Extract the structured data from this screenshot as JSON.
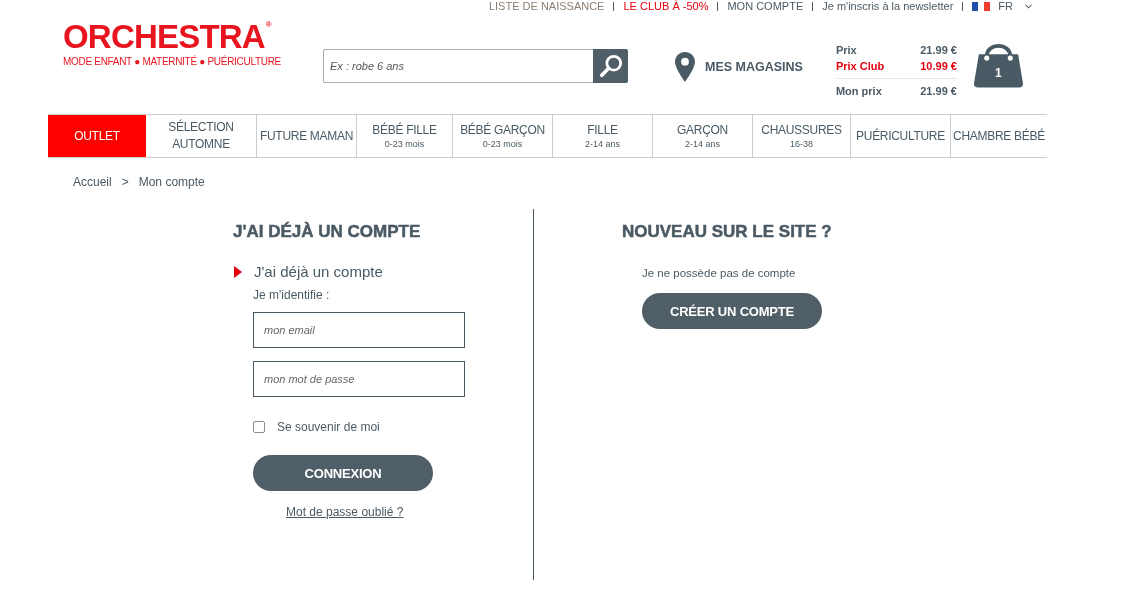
{
  "top_links": [
    {
      "label": "LISTE DE NAISSANCE",
      "color": "#8c7d70"
    },
    {
      "label": "LE CLUB À -50%",
      "color": "#e3000f"
    },
    {
      "label": "MON COMPTE",
      "color": "#4a5a64"
    },
    {
      "label": "Je m'inscris à la newsletter",
      "color": "#4a5a64"
    }
  ],
  "language": {
    "label": "FR"
  },
  "header": {
    "logo": {
      "name": "ORCHESTRA",
      "mark": "®",
      "tagline": "MODE ENFANT ● MATERNITÉ ● PUÉRICULTURE"
    },
    "search": {
      "placeholder": "Ex : robe 6 ans"
    },
    "stores": {
      "label": "MES MAGASINS"
    },
    "prices": [
      {
        "label": "Prix",
        "value": "21.99 €",
        "kind": "regular"
      },
      {
        "label": "Prix Club",
        "value": "10.99 €",
        "kind": "club"
      },
      {
        "label": "Mon prix",
        "value": "21.99 €",
        "kind": "total"
      }
    ],
    "cart": {
      "count": "1"
    }
  },
  "nav": [
    {
      "label": "OUTLET",
      "kind": "promo"
    },
    {
      "label": "SÉLECTION AUTOMNE",
      "kind": "category"
    },
    {
      "label": "FUTURE MAMAN",
      "kind": "category"
    },
    {
      "label": "BÉBÉ FILLE",
      "sublabel": "0-23 mois",
      "kind": "category"
    },
    {
      "label": "BÉBÉ GARÇON",
      "sublabel": "0-23 mois",
      "kind": "category"
    },
    {
      "label": "FILLE",
      "sublabel": "2-14 ans",
      "kind": "category"
    },
    {
      "label": "GARÇON",
      "sublabel": "2-14 ans",
      "kind": "category"
    },
    {
      "label": "CHAUSSURES",
      "sublabel": "16-38",
      "kind": "category"
    },
    {
      "label": "PUÉRICULTURE",
      "kind": "category"
    },
    {
      "label": "CHAMBRE BÉBÉ",
      "kind": "category"
    }
  ],
  "breadcrumb": {
    "items": [
      {
        "label": "Accueil"
      },
      {
        "label": "Mon compte"
      }
    ],
    "separator": ">"
  },
  "login": {
    "heading": "J'AI DÉJÀ UN COMPTE",
    "subheading": "J'ai déjà un compte",
    "prompt": "Je m'identifie :",
    "email": {
      "placeholder": "mon email"
    },
    "password": {
      "placeholder": "mon mot de passe"
    },
    "remember": {
      "label": "Se souvenir de moi",
      "checked": false
    },
    "button": "CONNEXION",
    "forgot_link": "Mot de passe oublié ?"
  },
  "register": {
    "heading": "NOUVEAU SUR LE SITE ?",
    "text": "Je ne possède pas de compte",
    "button": "CRÉER UN COMPTE"
  }
}
